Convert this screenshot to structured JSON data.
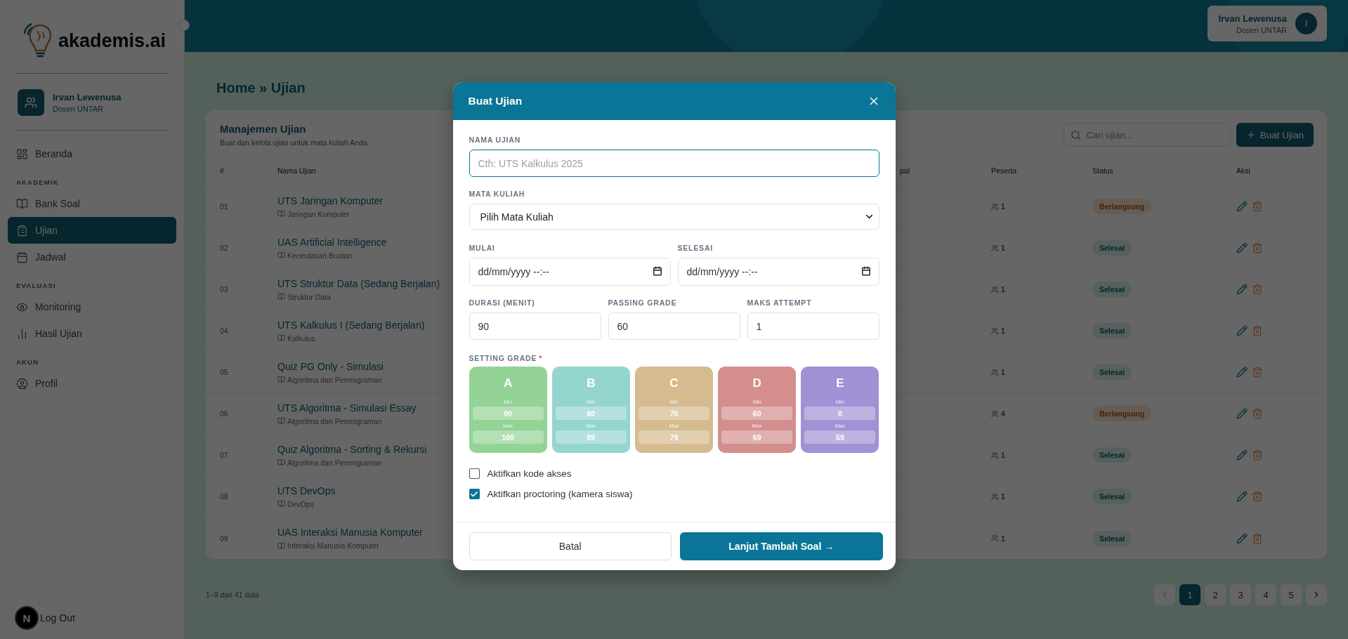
{
  "sidebar": {
    "brand": "akademis.ai",
    "user": {
      "name": "Irvan Lewenusa",
      "role": "Dosen UNTAR"
    },
    "groups": [
      {
        "items": [
          {
            "label": "Beranda",
            "selected": false
          }
        ]
      },
      {
        "heading": "AKADEMIK",
        "items": [
          {
            "label": "Bank Soal",
            "selected": false
          },
          {
            "label": "Ujian",
            "selected": true
          },
          {
            "label": "Jadwal",
            "selected": false
          }
        ]
      },
      {
        "heading": "EVALUASI",
        "items": [
          {
            "label": "Monitoring",
            "selected": false
          },
          {
            "label": "Hasil Ujian",
            "selected": false
          }
        ]
      },
      {
        "heading": "AKUN",
        "items": [
          {
            "label": "Profil",
            "selected": false
          }
        ]
      }
    ],
    "logout": "Log Out",
    "dev_badge": "N"
  },
  "header": {
    "user_name": "Irvan Lewenusa",
    "user_role": "Dosen UNTAR",
    "avatar": "I"
  },
  "breadcrumb": "Home » Ujian",
  "card": {
    "title": "Manajemen Ujian",
    "subtitle": "Buat dan kelola ujian untuk mata kuliah Anda.",
    "search": {
      "placeholder": "Cari ujian..."
    },
    "create_button": "Buat Ujian"
  },
  "table": {
    "columns": [
      "#",
      "Nama Ujian",
      "pal",
      "Peserta",
      "Status",
      "Aksi"
    ],
    "rows": [
      {
        "no": "01",
        "name": "UTS Jaringan Komputer",
        "course": "Jaringan Komputer",
        "participants": "1",
        "status": {
          "label": "Berlangsung",
          "kind": "ongoing"
        }
      },
      {
        "no": "02",
        "name": "UAS Artificial Intelligence",
        "course": "Kecerdasan Buatan",
        "participants": "1",
        "status": {
          "label": "Selesai",
          "kind": "done"
        }
      },
      {
        "no": "03",
        "name": "UTS Struktur Data (Sedang Berjalan)",
        "course": "Struktur Data",
        "participants": "1",
        "status": {
          "label": "Selesai",
          "kind": "done"
        }
      },
      {
        "no": "04",
        "name": "UTS Kalkulus I (Sedang Berjalan)",
        "course": "Kalkulus",
        "participants": "1",
        "status": {
          "label": "Selesai",
          "kind": "done"
        }
      },
      {
        "no": "05",
        "name": "Quiz PG Only - Simulasi",
        "course": "Algoritma dan Pemrograman",
        "participants": "1",
        "status": {
          "label": "Selesai",
          "kind": "done"
        }
      },
      {
        "no": "06",
        "name": "UTS Algoritma - Simulasi Essay",
        "course": "Algoritma dan Pemrograman",
        "participants": "4",
        "status": {
          "label": "Berlangsung",
          "kind": "ongoing"
        }
      },
      {
        "no": "07",
        "name": "Quiz Algoritma - Sorting & Rekursi",
        "course": "Algoritma dan Pemrograman",
        "participants": "1",
        "status": {
          "label": "Selesai",
          "kind": "done"
        }
      },
      {
        "no": "08",
        "name": "UTS DevOps",
        "course": "DevOps",
        "participants": "1",
        "status": {
          "label": "Selesai",
          "kind": "done"
        }
      },
      {
        "no": "09",
        "name": "UAS Interaksi Manusia Komputer",
        "course": "Interaksi Manusia Komputer",
        "participants": "1",
        "status": {
          "label": "Selesai",
          "kind": "done"
        }
      }
    ]
  },
  "pagination": {
    "summary": "1–9 dari 41 data",
    "pages": [
      {
        "label": "1",
        "selected": true
      },
      {
        "label": "2",
        "selected": false
      },
      {
        "label": "3",
        "selected": false
      },
      {
        "label": "4",
        "selected": false
      },
      {
        "label": "5",
        "selected": false
      }
    ]
  },
  "modal": {
    "title": "Buat Ujian",
    "name_field": {
      "label": "NAMA UJIAN",
      "placeholder": "Cth: UTS Kalkulus 2025"
    },
    "course_field": {
      "label": "MATA KULIAH",
      "value": "Pilih Mata Kuliah"
    },
    "date_fields": [
      {
        "label": "MULAI",
        "placeholder": "dd/mm/yyyy --:--"
      },
      {
        "label": "SELESAI",
        "placeholder": "dd/mm/yyyy --:--"
      }
    ],
    "number_fields": [
      {
        "label": "DURASI (MENIT)",
        "value": "90"
      },
      {
        "label": "PASSING GRADE",
        "value": "60"
      },
      {
        "label": "MAKS ATTEMPT",
        "value": "1"
      }
    ],
    "grade_label": "SETTING GRADE",
    "required_mark": "*",
    "grades": [
      {
        "letter": "A",
        "color": "#93d396",
        "min_label": "Min",
        "min": "90",
        "max_label": "Max",
        "max": "100"
      },
      {
        "letter": "B",
        "color": "#95d5d0",
        "min_label": "Min",
        "min": "80",
        "max_label": "Max",
        "max": "89"
      },
      {
        "letter": "C",
        "color": "#d5bb8f",
        "min_label": "Min",
        "min": "70",
        "max_label": "Max",
        "max": "79"
      },
      {
        "letter": "D",
        "color": "#d48e8e",
        "min_label": "Min",
        "min": "60",
        "max_label": "Max",
        "max": "69"
      },
      {
        "letter": "E",
        "color": "#a291d5",
        "min_label": "Min",
        "min": "0",
        "max_label": "Max",
        "max": "59"
      }
    ],
    "options": [
      {
        "label": "Aktifkan kode akses",
        "checked": false
      },
      {
        "label": "Aktifkan proctoring (kamera siswa)",
        "checked": true
      }
    ],
    "cancel": "Batal",
    "submit": "Lanjut Tambah Soal →"
  }
}
